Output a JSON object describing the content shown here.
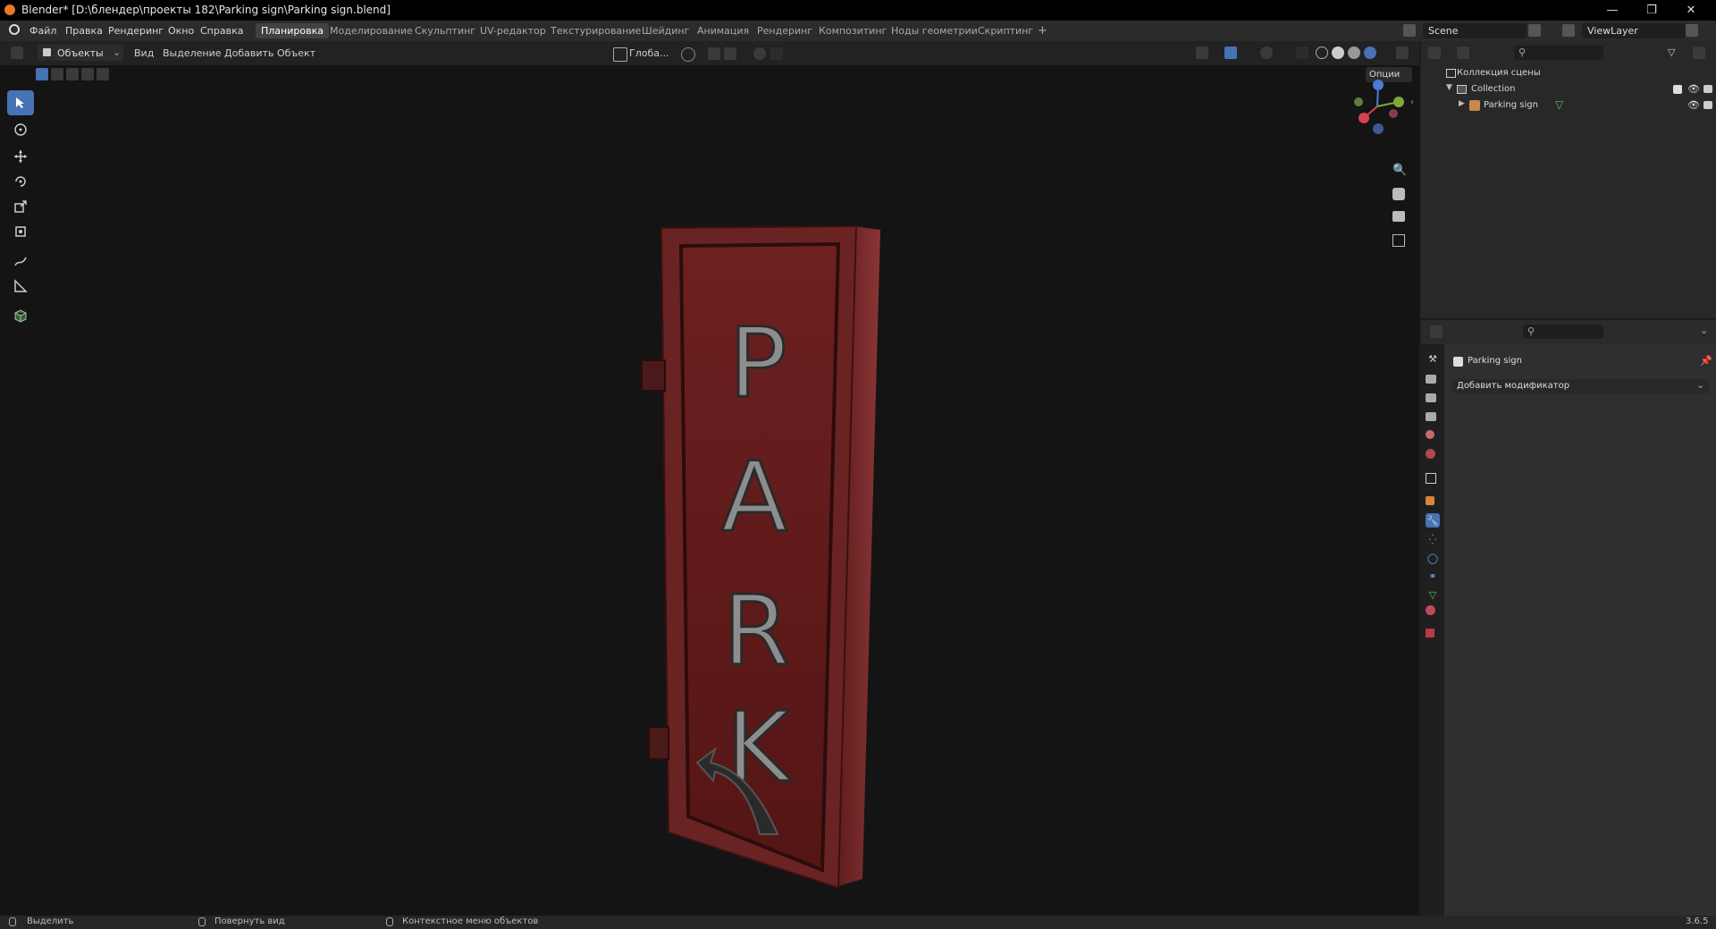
{
  "window": {
    "title": "Blender* [D:\\блендер\\проекты 182\\Parking sign\\Parking sign.blend]",
    "minimize_icon": "minimize-icon",
    "restore_icon": "restore-icon",
    "close_icon": "close-icon"
  },
  "menu": {
    "file": "Файл",
    "edit": "Правка",
    "render": "Рендеринг",
    "window": "Окно",
    "help": "Справка"
  },
  "workspaces": [
    "Планировка",
    "Моделирование",
    "Скульптинг",
    "UV-редактор",
    "Текстурирование",
    "Шейдинг",
    "Анимация",
    "Рендеринг",
    "Композитинг",
    "Ноды геометрии",
    "Скриптинг"
  ],
  "workspace_add": "+",
  "scene": {
    "name": "Scene",
    "view_layer": "ViewLayer"
  },
  "viewport_header": {
    "mode": "Объекты",
    "view": "Вид",
    "select": "Выделение",
    "add": "Добавить",
    "object": "Объект",
    "orientation": "Глоба...",
    "options": "Опции"
  },
  "model": {
    "letters": [
      "P",
      "A",
      "R",
      "K"
    ]
  },
  "outliner": {
    "root": "Коллекция сцены",
    "collection": "Collection",
    "object": "Parking sign"
  },
  "properties": {
    "object_name": "Parking sign",
    "add_modifier": "Добавить модификатор"
  },
  "status": {
    "select": "Выделить",
    "rotate_view": "Повернуть вид",
    "context_menu": "Контекстное меню объектов",
    "version": "3.6.5"
  },
  "colors": {
    "accent": "#4772b3",
    "active_tab": "#414141",
    "viewport_bg": "#141414",
    "sign_red": "#7a1f1f"
  }
}
